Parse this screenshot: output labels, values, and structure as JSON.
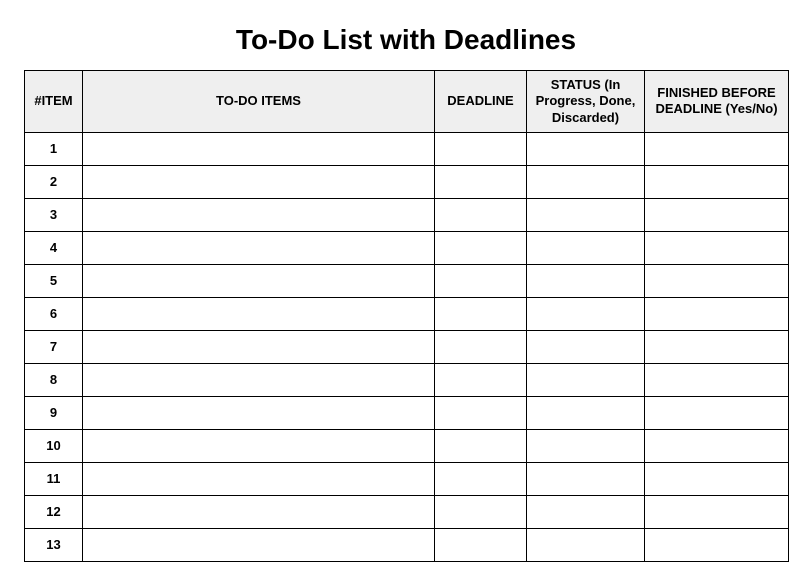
{
  "title": "To-Do List with Deadlines",
  "columns": {
    "item": "#ITEM",
    "todo": "TO-DO ITEMS",
    "deadline": "DEADLINE",
    "status": "STATUS (In Progress, Done, Discarded)",
    "finished": "FINISHED BEFORE DEADLINE (Yes/No)"
  },
  "rows": [
    {
      "num": "1",
      "todo": "",
      "deadline": "",
      "status": "",
      "finished": ""
    },
    {
      "num": "2",
      "todo": "",
      "deadline": "",
      "status": "",
      "finished": ""
    },
    {
      "num": "3",
      "todo": "",
      "deadline": "",
      "status": "",
      "finished": ""
    },
    {
      "num": "4",
      "todo": "",
      "deadline": "",
      "status": "",
      "finished": ""
    },
    {
      "num": "5",
      "todo": "",
      "deadline": "",
      "status": "",
      "finished": ""
    },
    {
      "num": "6",
      "todo": "",
      "deadline": "",
      "status": "",
      "finished": ""
    },
    {
      "num": "7",
      "todo": "",
      "deadline": "",
      "status": "",
      "finished": ""
    },
    {
      "num": "8",
      "todo": "",
      "deadline": "",
      "status": "",
      "finished": ""
    },
    {
      "num": "9",
      "todo": "",
      "deadline": "",
      "status": "",
      "finished": ""
    },
    {
      "num": "10",
      "todo": "",
      "deadline": "",
      "status": "",
      "finished": ""
    },
    {
      "num": "11",
      "todo": "",
      "deadline": "",
      "status": "",
      "finished": ""
    },
    {
      "num": "12",
      "todo": "",
      "deadline": "",
      "status": "",
      "finished": ""
    },
    {
      "num": "13",
      "todo": "",
      "deadline": "",
      "status": "",
      "finished": ""
    }
  ]
}
